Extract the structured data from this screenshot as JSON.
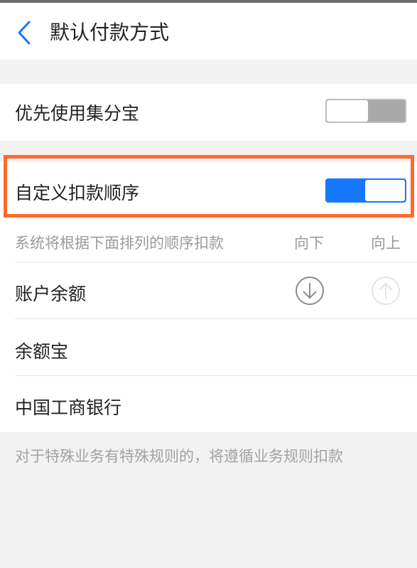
{
  "header": {
    "title": "默认付款方式",
    "back_icon": "chevron-left-icon",
    "accent_color": "#1677ff"
  },
  "prefer_jifenbao": {
    "label": "优先使用集分宝",
    "toggle_state": "off"
  },
  "custom_order": {
    "label": "自定义扣款顺序",
    "toggle_state": "on",
    "highlight_color": "#ff6a2c"
  },
  "order_list": {
    "description": "系统将根据下面排列的顺序扣款",
    "col_down": "向下",
    "col_up": "向上",
    "items": [
      {
        "label": "账户余额",
        "down_icon": "arrow-down-circle-icon",
        "up_icon": "arrow-up-circle-icon",
        "up_disabled": true
      },
      {
        "label": "余额宝"
      },
      {
        "label": "中国工商银行"
      }
    ]
  },
  "footnote": "对于特殊业务有特殊规则的，将遵循业务规则扣款"
}
